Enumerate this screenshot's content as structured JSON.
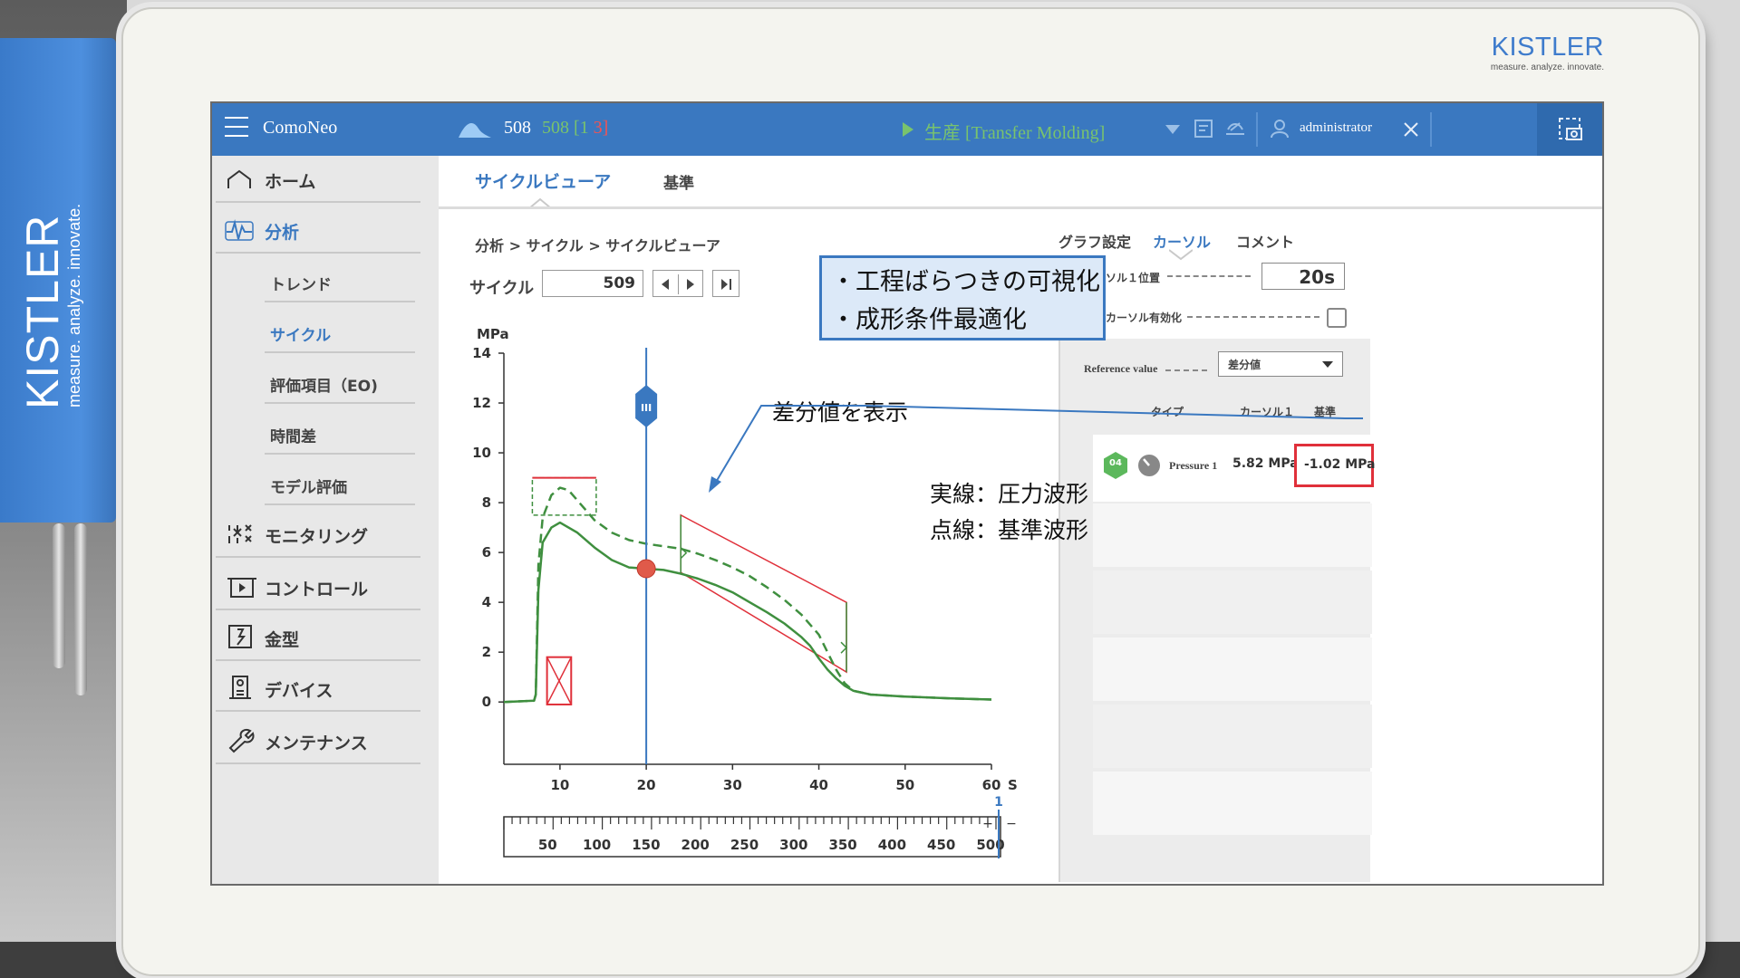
{
  "side_brand": {
    "name": "KISTLER",
    "tagline": "measure. analyze. innovate."
  },
  "tablet_brand": {
    "name": "KISTLER",
    "tagline": "measure. analyze. innovate."
  },
  "topbar": {
    "app_name": "ComoNeo",
    "cycle_current": "508",
    "cycle_info": "508 [1",
    "cycle_info_red": "3]",
    "mode_label": "生産 [Transfer Molding]",
    "user": "administrator"
  },
  "sidebar": {
    "home": "ホーム",
    "analysis": "分析",
    "sub_items": [
      "トレンド",
      "サイクル",
      "評価項目（EO)",
      "時間差",
      "モデル評価"
    ],
    "monitoring": "モニタリング",
    "control": "コントロール",
    "mold": "金型",
    "device": "デバイス",
    "maintenance": "メンテナンス"
  },
  "tabs": {
    "cycle_viewer": "サイクルビューア",
    "reference": "基準"
  },
  "breadcrumb": "分析 > サイクル > サイクルビューア",
  "cycle_selector": {
    "label": "サイクル",
    "value": "509"
  },
  "chart_data": {
    "type": "line",
    "ylabel": "MPa",
    "xlabel": "S",
    "y_ticks": [
      "14",
      "12",
      "10",
      "8",
      "6",
      "4",
      "2",
      "0"
    ],
    "x_ticks": [
      "10",
      "20",
      "30",
      "40",
      "50",
      "60"
    ],
    "xlim": [
      3.5,
      60
    ],
    "ylim": [
      -2.5,
      14
    ],
    "cursor_x": 20,
    "cursor_label": "III",
    "series": [
      {
        "name": "",
        "style": "solid",
        "color": "#3f8f3f",
        "x": [
          3.5,
          7,
          7.2,
          7.5,
          8,
          9,
          10,
          12,
          14,
          16,
          18,
          20,
          22,
          24,
          26,
          28,
          30,
          32,
          34,
          36,
          38,
          39,
          40,
          41,
          42,
          43,
          44,
          46,
          50,
          55,
          60
        ],
        "y": [
          0,
          0.05,
          0.3,
          4.5,
          6.4,
          7.0,
          7.2,
          6.8,
          6.2,
          5.7,
          5.4,
          5.35,
          5.3,
          5.15,
          4.95,
          4.7,
          4.4,
          4.0,
          3.6,
          3.15,
          2.6,
          2.25,
          1.75,
          1.3,
          0.95,
          0.65,
          0.45,
          0.3,
          0.22,
          0.15,
          0.1
        ]
      },
      {
        "name": "",
        "style": "dashed",
        "color": "#3f8f3f",
        "x": [
          3.5,
          7,
          7.2,
          7.5,
          8,
          9,
          10,
          11,
          12,
          14,
          16,
          18,
          20,
          22,
          24,
          26,
          28,
          30,
          32,
          34,
          36,
          38,
          40,
          41,
          42,
          43,
          44,
          46,
          50,
          55,
          60
        ],
        "y": [
          0,
          0.05,
          0.3,
          5.5,
          7.4,
          8.3,
          8.6,
          8.5,
          8.1,
          7.3,
          6.8,
          6.5,
          6.35,
          6.25,
          6.15,
          5.95,
          5.7,
          5.4,
          5.05,
          4.6,
          4.1,
          3.5,
          2.7,
          2.0,
          1.3,
          0.75,
          0.45,
          0.3,
          0.22,
          0.15,
          0.1
        ]
      }
    ],
    "annotation_boxes": [
      {
        "type": "dashed-rect",
        "x": [
          6.8,
          14.2
        ],
        "y": [
          7.5,
          9.0
        ]
      },
      {
        "type": "crossed-rect",
        "x": [
          8.5,
          11.3
        ],
        "y": [
          -0.1,
          1.8
        ]
      },
      {
        "type": "parallelogram",
        "x": [
          24,
          43.2
        ],
        "y_left": [
          7.5,
          5.2
        ],
        "y_right": [
          4.0,
          1.2
        ]
      }
    ],
    "marker": {
      "x": 20,
      "y": 5.35
    },
    "lower_scale": {
      "ticks": [
        "50",
        "100",
        "150",
        "200",
        "250",
        "300",
        "350",
        "400",
        "450",
        "500"
      ],
      "marker": "1",
      "plus": "+",
      "minus": "−"
    }
  },
  "callouts": {
    "box_lines": [
      "・工程ばらつきの可視化",
      "・成形条件最適化"
    ],
    "diff_label": "差分値を表示",
    "legend_solid": "実線：圧力波形",
    "legend_dashed": "点線：基準波形"
  },
  "right_panel": {
    "tabs": [
      "グラフ設定",
      "カーソル",
      "コメント"
    ],
    "cursor1_label": "カーソル１位置",
    "cursor1_value": "20s",
    "cursor2_label": "第２カーソル有効化",
    "ref_label": "Reference value",
    "ref_value": "差分値",
    "table_headers": [
      "タイプ",
      "カーソル１",
      "基準"
    ],
    "row": {
      "badge": "04",
      "name": "Pressure 1",
      "value": "5.82 MPa",
      "diff": "-1.02 MPa"
    }
  },
  "colors": {
    "accent_blue": "#3a78c0",
    "series_green": "#3f8f3f",
    "highlight_red": "#e0303a",
    "sidebar_bg": "#e8e8e8"
  }
}
